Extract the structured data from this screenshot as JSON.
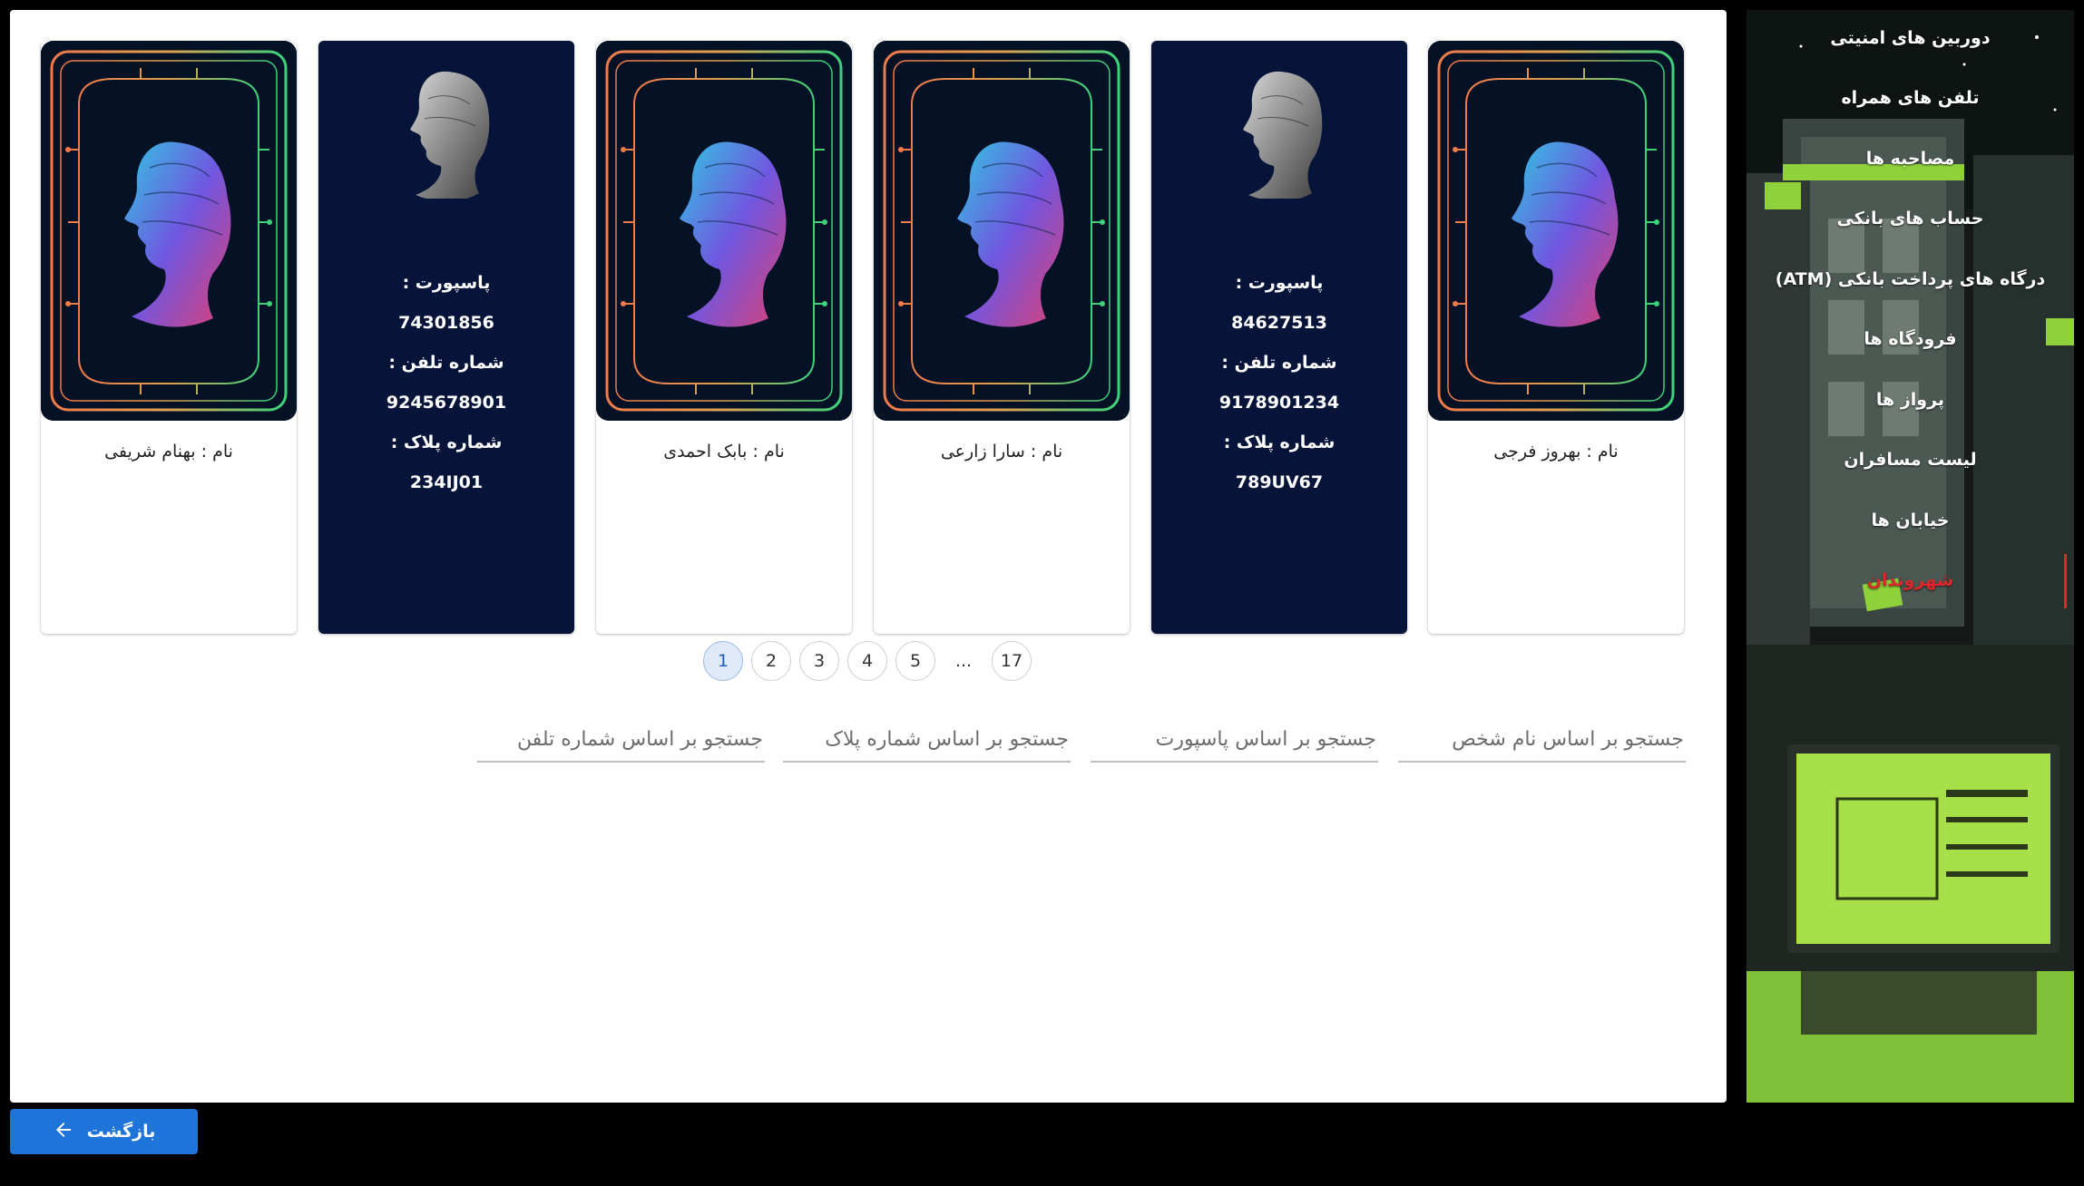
{
  "sidebar": {
    "items": [
      {
        "label": "دوربین های امنیتی",
        "active": false
      },
      {
        "label": "تلفن های همراه",
        "active": false
      },
      {
        "label": "مصاحبه ها",
        "active": false
      },
      {
        "label": "حساب های بانکی",
        "active": false
      },
      {
        "label": "درگاه های پرداخت بانکی (ATM)",
        "active": false
      },
      {
        "label": "فرودگاه ها",
        "active": false
      },
      {
        "label": "پرواز ها",
        "active": false
      },
      {
        "label": "لیست مسافران",
        "active": false
      },
      {
        "label": "خیابان ها",
        "active": false
      },
      {
        "label": "شهروندان",
        "active": true
      }
    ]
  },
  "cards": [
    {
      "type": "front",
      "name": "نام : بهروز فرجی"
    },
    {
      "type": "back",
      "passport_label": "پاسپورت :",
      "passport": "84627513",
      "phone_label": "شماره تلفن :",
      "phone": "9178901234",
      "plate_label": "شماره پلاک :",
      "plate": "789UV67"
    },
    {
      "type": "front",
      "name": "نام : سارا زارعی"
    },
    {
      "type": "front",
      "name": "نام : بابک احمدی"
    },
    {
      "type": "back",
      "passport_label": "پاسپورت :",
      "passport": "74301856",
      "phone_label": "شماره تلفن :",
      "phone": "9245678901",
      "plate_label": "شماره پلاک :",
      "plate": "234IJ01"
    },
    {
      "type": "front",
      "name": "نام : بهنام شریفی"
    }
  ],
  "pagination": {
    "pages": [
      "1",
      "2",
      "3",
      "4",
      "5"
    ],
    "ellipsis": "...",
    "last": "17",
    "current": "1"
  },
  "search": {
    "name_placeholder": "جستجو بر اساس نام شخص",
    "passport_placeholder": "جستجو بر اساس پاسپورت",
    "plate_placeholder": "جستجو بر اساس شماره پلاک",
    "phone_placeholder": "جستجو بر اساس شماره تلفن"
  },
  "back_button": {
    "label": "بازگشت",
    "icon": "arrow-left-icon"
  },
  "colors": {
    "card_back": "#06143a",
    "active_page_bg": "#dfe9f7",
    "accent_button": "#1e74d8",
    "active_menu": "#e0262c",
    "sidebar_green": "#8ed13a"
  }
}
